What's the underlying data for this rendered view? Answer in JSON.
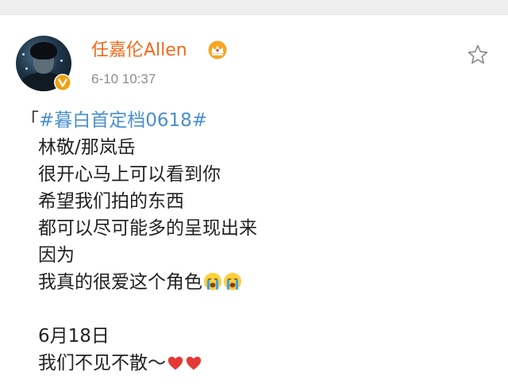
{
  "post": {
    "username": "任嘉伦Allen",
    "timestamp": "6-10 10:37",
    "hashtag_open": "「",
    "hashtag": "#暮白首定档0618#",
    "lines": [
      "林敬/那岚岳",
      "很开心马上可以看到你",
      "希望我们拍的东西",
      "都可以尽可能多的呈现出来",
      "因为",
      "我真的很爱这个角色",
      "",
      "6月18日",
      "我们不见不散～"
    ]
  },
  "icons": {
    "crown": "crown-vip-icon",
    "verified": "verified-v-icon",
    "star": "star-favorite-icon",
    "crying": "crying-face-emoji",
    "heart": "red-heart-emoji"
  },
  "colors": {
    "username": "#f06a1c",
    "hashtag": "#4a8fce",
    "verified_badge": "#f0a010",
    "heart": "#e53935"
  }
}
